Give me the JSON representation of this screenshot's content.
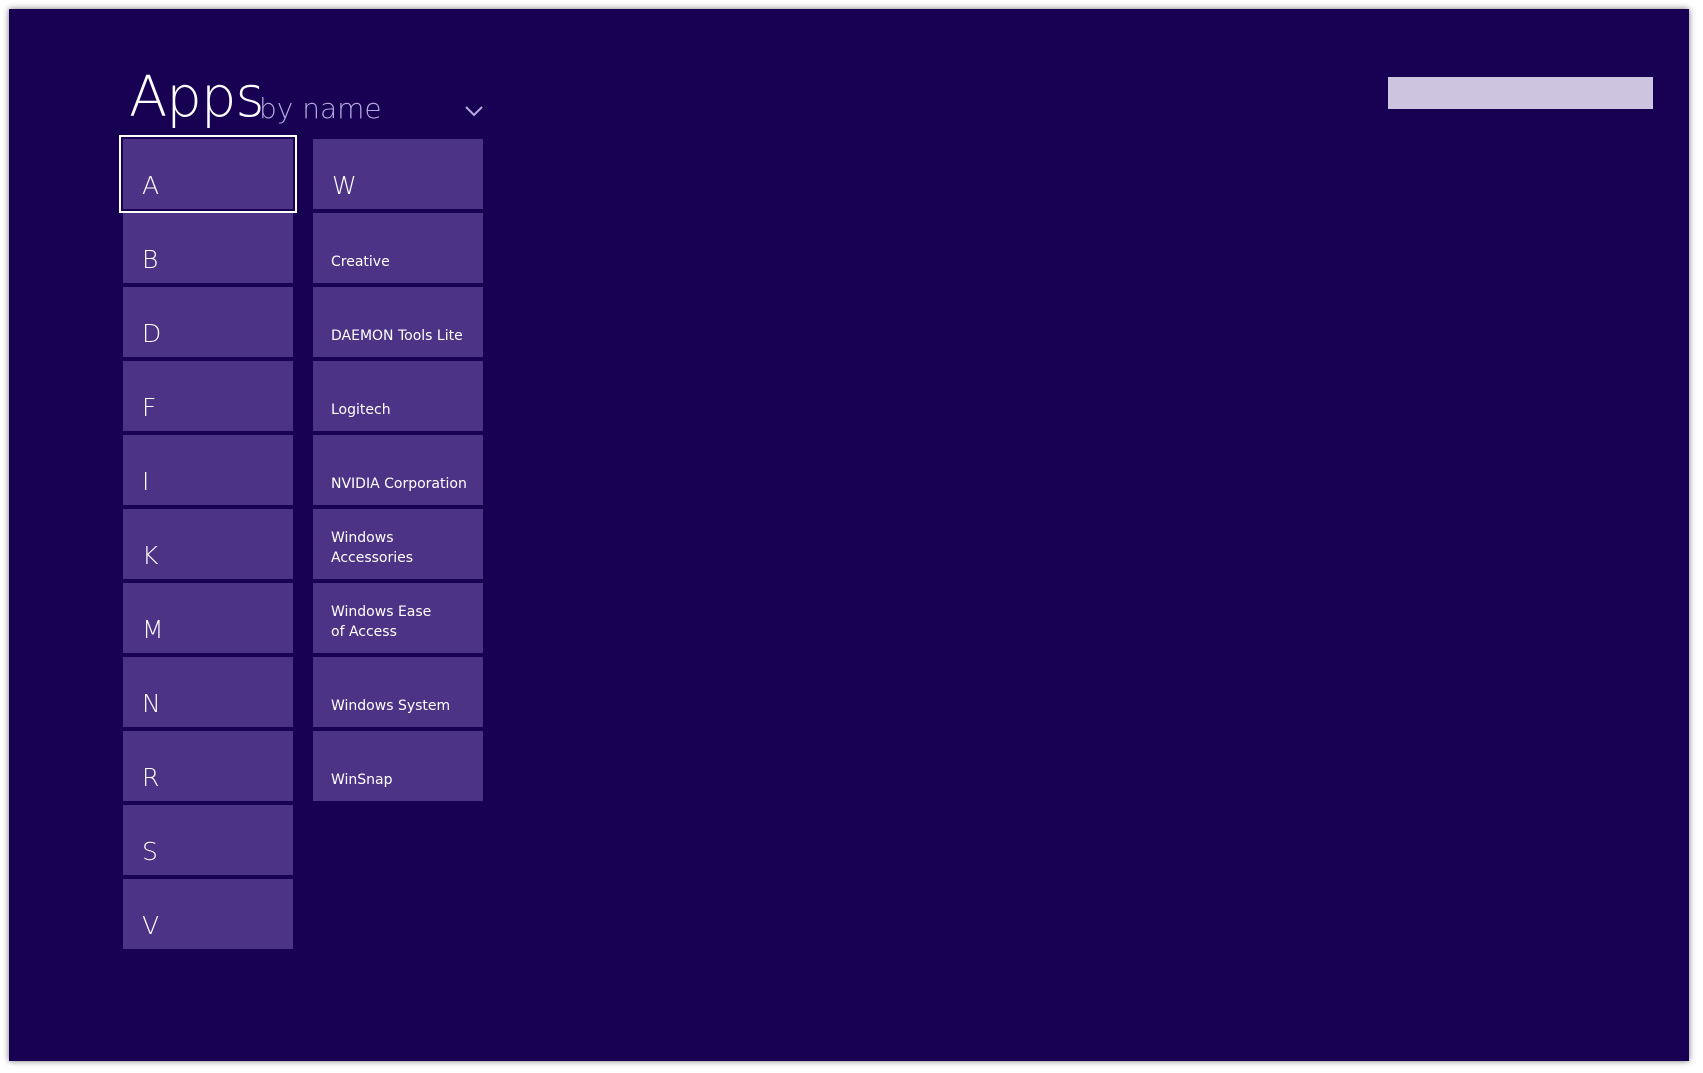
{
  "header": {
    "title": "Apps",
    "sort_label": "by name",
    "sort_icon": "chevron-down-icon"
  },
  "search": {
    "value": "",
    "placeholder": ""
  },
  "colors": {
    "background": "#180052",
    "tile": "#4d3386",
    "subtitle": "#b9a9e2",
    "search_box": "#cdc5e0"
  },
  "letter_tiles": [
    "A",
    "B",
    "D",
    "F",
    "I",
    "K",
    "M",
    "N",
    "R",
    "S",
    "V",
    "W"
  ],
  "group_tiles": [
    "Creative",
    "DAEMON Tools Lite",
    "Logitech",
    "NVIDIA Corporation",
    "Windows Accessories",
    "Windows Ease of Access",
    "Windows System",
    "WinSnap"
  ],
  "selected_tile": "A"
}
